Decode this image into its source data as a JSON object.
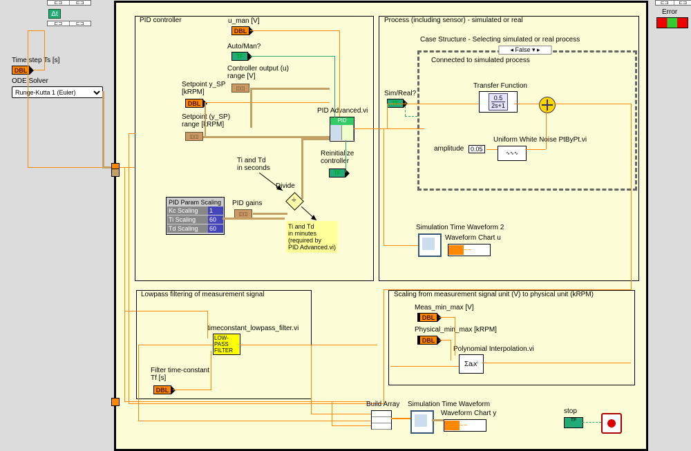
{
  "left_panel": {
    "dt_icon": "Δt",
    "timestep_label": "Time step Ts [s]",
    "ode_label": "ODE Solver",
    "ode_value": "Runge-Kutta 1 (Euler)"
  },
  "error_label": "Error",
  "pid": {
    "title": "PID controller",
    "u_man": "u_man [V]",
    "auto_man": "Auto/Man?",
    "out_label": "Controller output (u)\nrange [V]",
    "sp_label": "Setpoint y_SP\n[kRPM]",
    "sp_range": "Setpoint (y_SP)\nrange [kRPM]",
    "gains_label": "PID gains",
    "scaling": {
      "title": "PID Param Scaling",
      "rows": [
        {
          "l": "Kc Scaling",
          "v": "1"
        },
        {
          "l": "Ti Scaling",
          "v": "60"
        },
        {
          "l": "Td Scaling",
          "v": "60"
        }
      ]
    },
    "ti_td_s": "Ti and Td\nin seconds",
    "divide": "Divide",
    "ti_td_note": "Ti and Td\nin minutes\n(required by\nPID Advanced.vi)",
    "reinit": "Reinitialize\ncontroller",
    "vi_name": "PID Advanced.vi"
  },
  "process": {
    "title": "Process (including sensor) - simulated or real",
    "case_label": "Case Structure - Selecting simulated or real process",
    "case_sel": "False",
    "sim_real": "Sim/Real?",
    "conn_label": "Connected to simulated process",
    "tf_label": "Transfer Function",
    "tf_eq_top": "0.5",
    "tf_eq_bot": "2s+1",
    "amp_label": "amplitude",
    "amp_val": "0.05",
    "noise_label": "Uniform White Noise PtByPt.vi",
    "sim_wave2": "Simulation Time Waveform 2",
    "chart_u": "Waveform Chart u"
  },
  "lowpass": {
    "title": "Lowpass filtering of measurement signal",
    "vi_label": "timeconstant_lowpass_filter.vi",
    "vi_text": "LOW-\nPASS\nFILTER",
    "tf_label": "Filter time-constant\nTf [s]"
  },
  "scaling": {
    "title": "Scaling from measurement signal unit (V) to physical unit (kRPM)",
    "meas_label": "Meas_min_max [V]",
    "phys_label": "Physical_min_max [kRPM]",
    "poly_label": "Polynomial Interpolation.vi",
    "poly_sym": "Σaᵢxⁱ"
  },
  "footer": {
    "build": "Build Array",
    "sim_wave": "Simulation Time Waveform",
    "chart_y": "Waveform Chart y",
    "stop": "stop"
  },
  "dbl_text": "DBL",
  "tf_text": "TF",
  "cluster_text": "◫◫"
}
